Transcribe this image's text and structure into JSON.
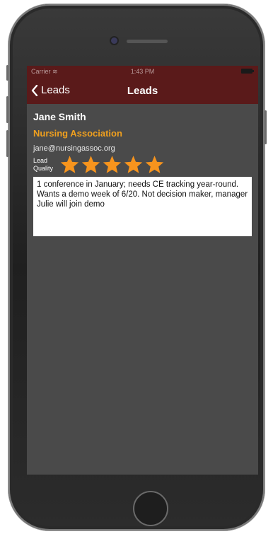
{
  "status_bar": {
    "carrier": "Carrier",
    "time": "1:43 PM"
  },
  "nav": {
    "back_label": "Leads",
    "title": "Leads"
  },
  "lead": {
    "name": "Jane Smith",
    "organization": "Nursing Association",
    "email": "jane@nursingassoc.org",
    "quality_label_line1": "Lead",
    "quality_label_line2": "Quality",
    "quality_stars": 5,
    "quality_max": 5,
    "notes": "1 conference in January; needs CE tracking year-round.  Wants a demo week of 6/20.  Not decision maker, manager Julie will join demo"
  },
  "colors": {
    "nav_background": "#5a1a1a",
    "screen_background": "#4a4a4a",
    "organization_text": "#f0a01e",
    "star_fill": "#f7941d"
  },
  "icons": {
    "back": "chevron-left-icon",
    "star": "star-icon",
    "battery": "battery-icon",
    "wifi": "wifi-icon"
  }
}
